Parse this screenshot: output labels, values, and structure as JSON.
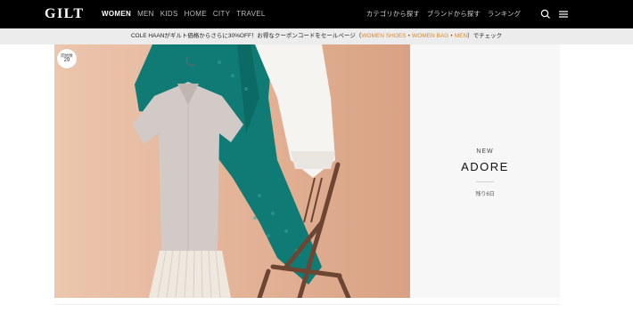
{
  "header": {
    "logo": "GILT",
    "categories": [
      "WOMEN",
      "MEN",
      "KIDS",
      "HOME",
      "CITY",
      "TRAVEL"
    ],
    "active_category": "WOMEN",
    "right_links": [
      "カテゴリから探す",
      "ブランドから探す",
      "ランキング"
    ],
    "icons": [
      "search-icon",
      "hamburger-menu-icon"
    ]
  },
  "promo": {
    "text_before": "COLE HAANがギルト価格からさらに30%OFF！お得なクーポンコードをセールページ（",
    "link_women_shoes": "WOMEN SHOES",
    "sep1": "・",
    "link_women_bag": "WOMEN BAG",
    "sep2": "・",
    "link_men": "MEN",
    "text_after": "）でチェック"
  },
  "hero": {
    "badge_label": "開始数",
    "badge_number": "29",
    "tag": "NEW",
    "brand": "ADORE",
    "remaining": "残り6日"
  },
  "colors": {
    "nav_bg": "#000000",
    "promo_bg": "#ececec",
    "promo_link": "#d98a32",
    "hero_bg": "#e3b79c",
    "panel_bg": "#f7f7f7"
  }
}
